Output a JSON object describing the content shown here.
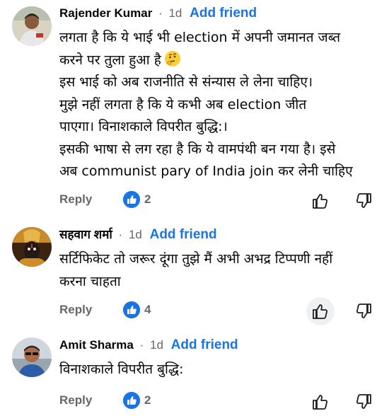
{
  "comments": [
    {
      "author": "Rajender Kumar",
      "separator": "·",
      "time": "1d",
      "add_friend": "Add friend",
      "lines": [
        "लगता है कि ये भाई भी election में अपनी जमानत जब्त",
        "करने पर तुला हुआ है",
        "इस भाई को अब राजनीति से संन्यास ले लेना चाहिए।",
        "मुझे नहीं लगता है कि ये कभी अब election जीत",
        "पाएगा। विनाशकाले विपरीत बुद्धि:।",
        " इसकी भाषा से लग रहा है कि ये वामपंथी बन गया है। इसे",
        "अब communist pary of India join कर लेनी चाहिए"
      ],
      "reply": "Reply",
      "likes": "2"
    },
    {
      "author": "सहवाग शर्मा",
      "separator": "·",
      "time": "1d",
      "add_friend": "Add friend",
      "lines": [
        "सर्टिफिकेट तो जरूर दूंगा तुझे मैं अभी अभद्र टिप्पणी नहीं",
        "करना चाहता"
      ],
      "reply": "Reply",
      "likes": "4"
    },
    {
      "author": "Amit Sharma",
      "separator": "·",
      "time": "1d",
      "add_friend": "Add friend",
      "lines": [
        "विनाशकाले विपरीत बुद्धि:"
      ],
      "reply": "Reply",
      "likes": "2"
    }
  ],
  "icons": {
    "like_badge": "thumbs-up-badge-icon",
    "like": "thumbs-up-outline-icon",
    "dislike": "thumbs-down-outline-icon",
    "emoji": "thinking-face-emoji"
  },
  "colors": {
    "link": "#1b74e4",
    "muted": "#65676b",
    "text": "#050505"
  }
}
